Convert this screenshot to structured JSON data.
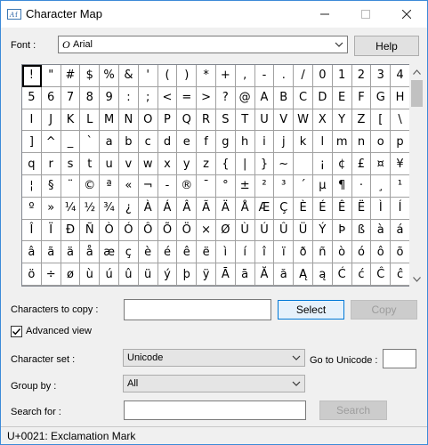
{
  "window": {
    "title": "Character Map",
    "minimize_label": "—",
    "maximize_label": "☐",
    "close_label": "✕"
  },
  "font_row": {
    "label": "Font :",
    "icon": "O",
    "value": "Arial",
    "help_label": "Help"
  },
  "characters": [
    "!",
    "\"",
    "#",
    "$",
    "%",
    "&",
    "'",
    "(",
    ")",
    "*",
    "+",
    ",",
    "-",
    ".",
    "/",
    "0",
    "1",
    "2",
    "3",
    "4",
    "5",
    "6",
    "7",
    "8",
    "9",
    ":",
    ";",
    "<",
    "=",
    ">",
    "?",
    "@",
    "A",
    "B",
    "C",
    "D",
    "E",
    "F",
    "G",
    "H",
    "I",
    "J",
    "K",
    "L",
    "M",
    "N",
    "O",
    "P",
    "Q",
    "R",
    "S",
    "T",
    "U",
    "V",
    "W",
    "X",
    "Y",
    "Z",
    "[",
    "\\",
    "]",
    "^",
    "_",
    "`",
    "a",
    "b",
    "c",
    "d",
    "e",
    "f",
    "g",
    "h",
    "i",
    "j",
    "k",
    "l",
    "m",
    "n",
    "o",
    "p",
    "q",
    "r",
    "s",
    "t",
    "u",
    "v",
    "w",
    "x",
    "y",
    "z",
    "{",
    "|",
    "}",
    "~",
    " ",
    "¡",
    "¢",
    "£",
    "¤",
    "¥",
    "¦",
    "§",
    "¨",
    "©",
    "ª",
    "«",
    "¬",
    "-",
    "®",
    "¯",
    "°",
    "±",
    "²",
    "³",
    "´",
    "µ",
    "¶",
    "·",
    "¸",
    "¹",
    "º",
    "»",
    "¼",
    "½",
    "¾",
    "¿",
    "À",
    "Á",
    "Â",
    "Ã",
    "Ä",
    "Å",
    "Æ",
    "Ç",
    "È",
    "É",
    "Ê",
    "Ë",
    "Ì",
    "Í",
    "Î",
    "Ï",
    "Ð",
    "Ñ",
    "Ò",
    "Ó",
    "Ô",
    "Õ",
    "Ö",
    "×",
    "Ø",
    "Ù",
    "Ú",
    "Û",
    "Ü",
    "Ý",
    "Þ",
    "ß",
    "à",
    "á",
    "â",
    "ã",
    "ä",
    "å",
    "æ",
    "ç",
    "è",
    "é",
    "ê",
    "ë",
    "ì",
    "í",
    "î",
    "ï",
    "ð",
    "ñ",
    "ò",
    "ó",
    "ô",
    "õ",
    "ö",
    "÷",
    "ø",
    "ù",
    "ú",
    "û",
    "ü",
    "ý",
    "þ",
    "ÿ",
    "Ā",
    "ā",
    "Ă",
    "ă",
    "Ą",
    "ą",
    "Ć",
    "ć",
    "Ĉ",
    "ĉ"
  ],
  "selected_index": 0,
  "copy_row": {
    "label": "Characters to copy :",
    "value": "",
    "select_label": "Select",
    "copy_label": "Copy"
  },
  "advanced": {
    "label": "Advanced view",
    "checked": true,
    "check_glyph": "✓"
  },
  "charset_row": {
    "label": "Character set :",
    "value": "Unicode",
    "goto_label": "Go to Unicode :",
    "goto_value": ""
  },
  "groupby_row": {
    "label": "Group by :",
    "value": "All"
  },
  "search_row": {
    "label": "Search for :",
    "value": "",
    "search_label": "Search"
  },
  "status": {
    "text": "U+0021: Exclamation Mark"
  },
  "colors": {
    "accent": "#0078d7",
    "border": "#3c8ad8"
  }
}
